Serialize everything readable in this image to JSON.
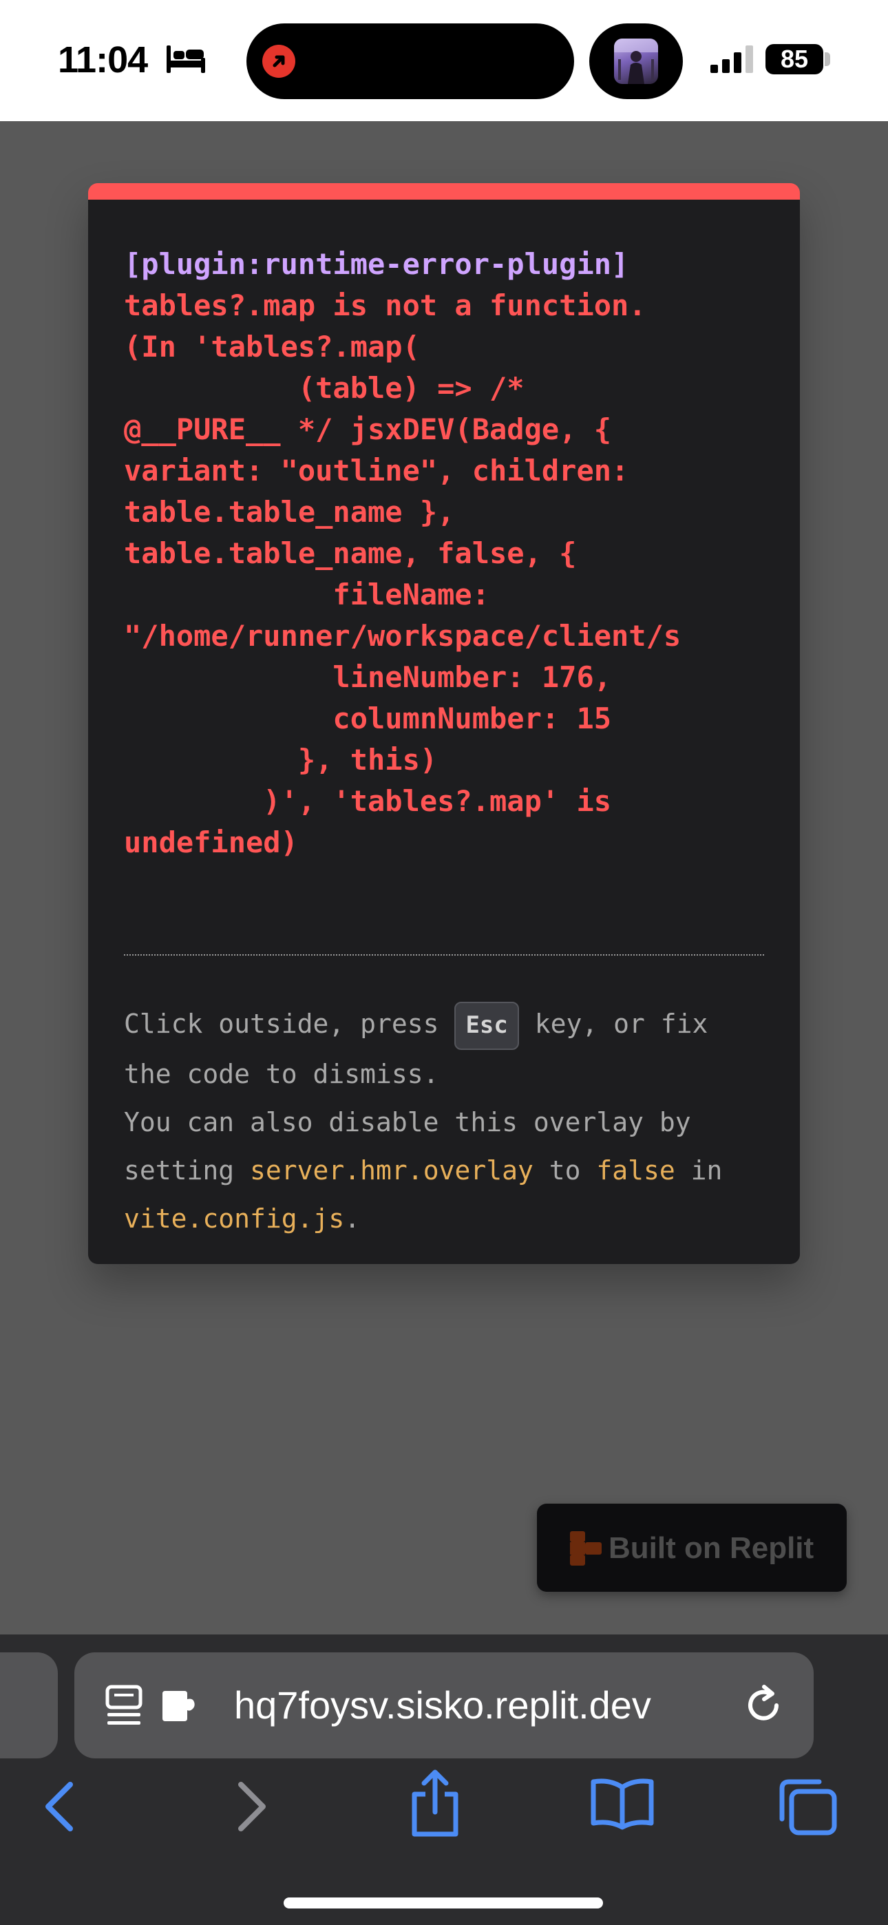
{
  "status_bar": {
    "time": "11:04",
    "focus_icon": "bed-icon",
    "live_activity_icon": "screen-recording-icon",
    "media_icon": "album-art",
    "signal_icon": "cellular-signal-icon",
    "battery_percent": "85"
  },
  "error_overlay": {
    "accent_color": "#ff5555",
    "plugin": "[plugin:runtime-error-plugin]",
    "message_lines": [
      "tables?.map is not a function.",
      "(In 'tables?.map(",
      "          (table) => /*",
      "@__PURE__ */ jsxDEV(Badge, {",
      "variant: \"outline\", children:",
      "table.table_name },",
      "table.table_name, false, {",
      "            fileName:",
      "\"/home/runner/workspace/client/s",
      "            lineNumber: 176,",
      "            columnNumber: 15",
      "          }, this)",
      "        )', 'tables?.map' is",
      "undefined)"
    ],
    "tip": {
      "part1": "Click outside, press ",
      "key": "Esc",
      "part2": " key, or fix",
      "line2": "the code to dismiss.",
      "line3": "You can also disable this overlay by",
      "line4_prefix": "setting ",
      "config_key": "server.hmr.overlay",
      "line4_mid": " to ",
      "config_value": "false",
      "line4_suffix": " in",
      "config_file": "vite.config.js",
      "end": "."
    }
  },
  "replit_badge": {
    "label": "Built on Replit",
    "icon": "replit-logo-icon"
  },
  "browser": {
    "url": "hq7foysv.sisko.replit.dev",
    "reader_icon": "reader-mode-icon",
    "extension_icon": "extension-puzzle-icon",
    "reload_icon": "reload-icon",
    "toolbar": [
      "back-icon",
      "forward-icon",
      "share-icon",
      "bookmarks-icon",
      "tabs-icon"
    ],
    "accent_color": "#4c8cf5"
  }
}
